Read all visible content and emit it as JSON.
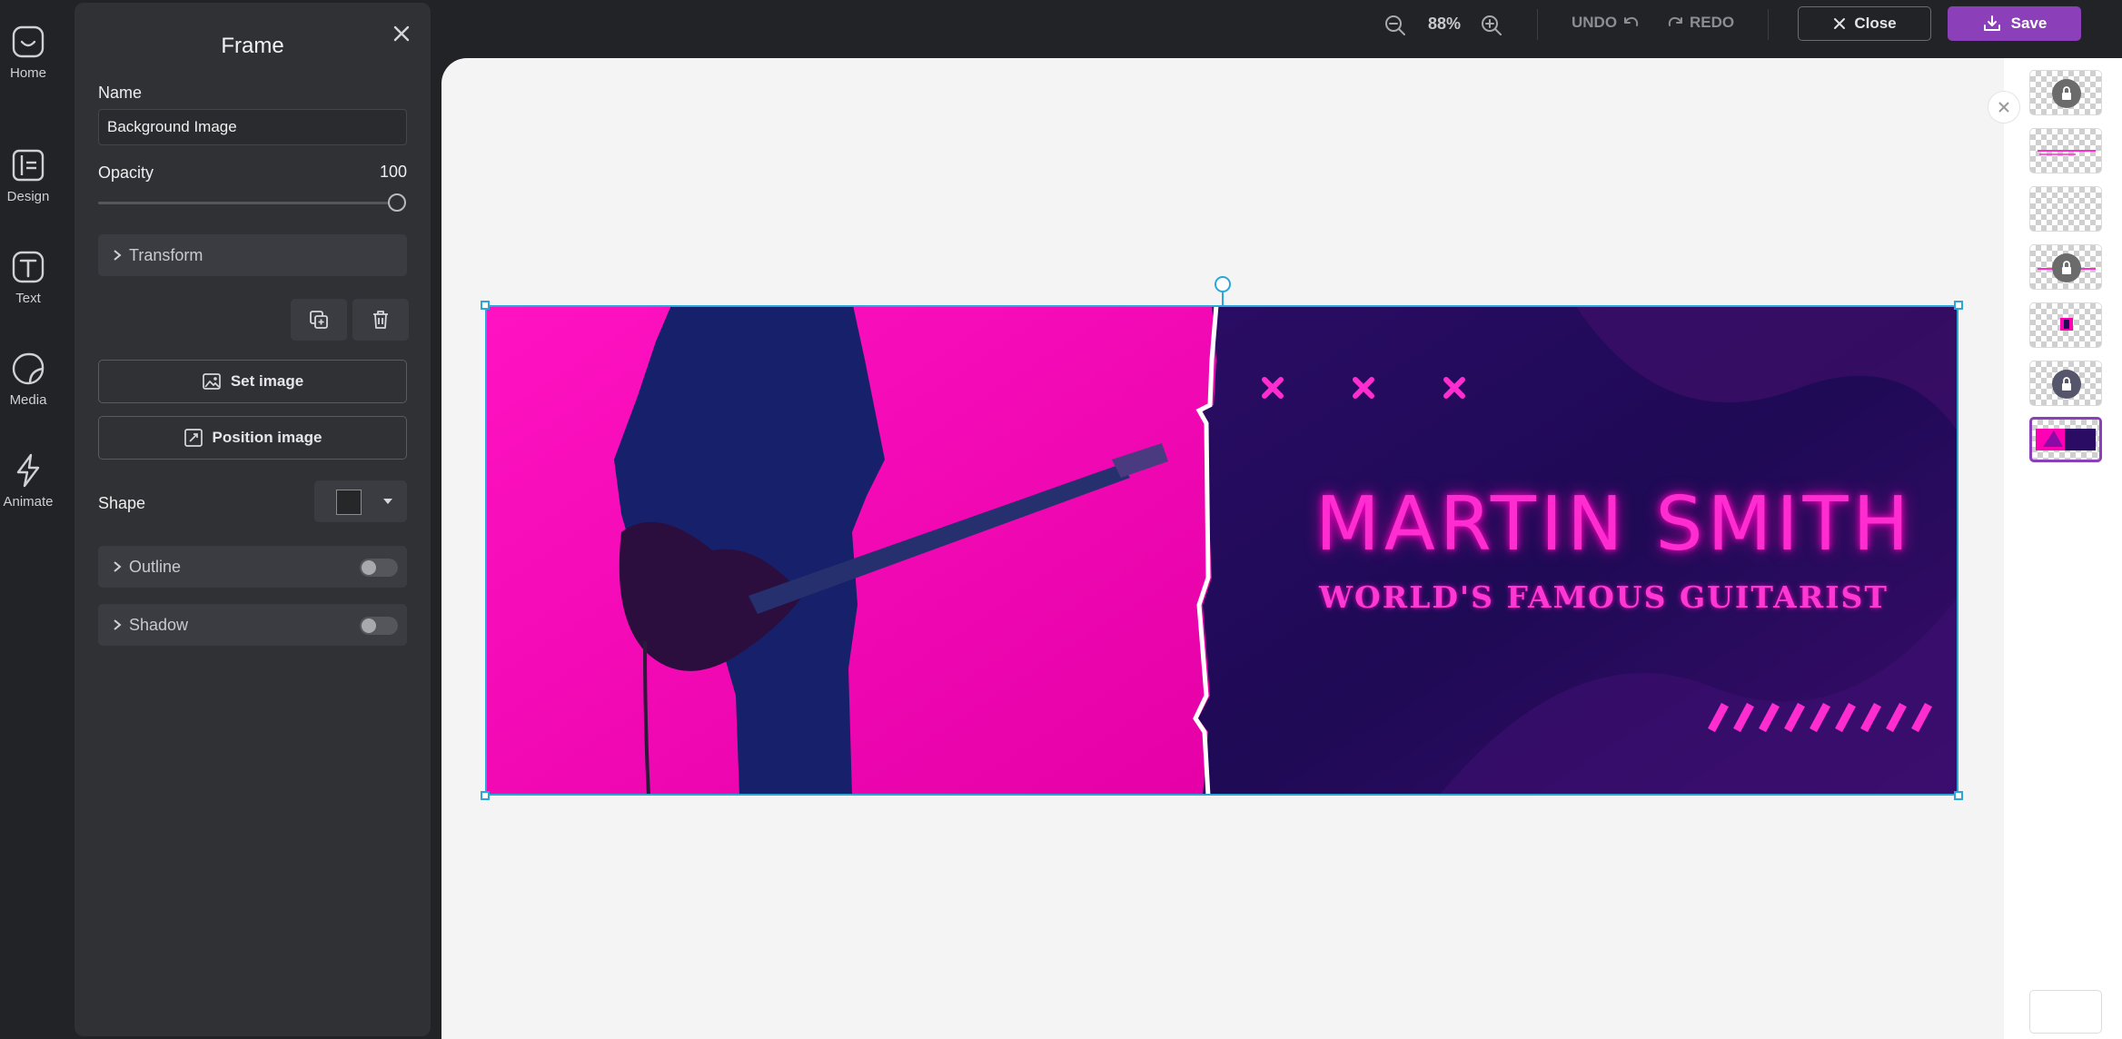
{
  "rail": {
    "items": [
      {
        "label": "Home",
        "icon": "home-icon"
      },
      {
        "label": "Design",
        "icon": "design-icon"
      },
      {
        "label": "Text",
        "icon": "text-icon"
      },
      {
        "label": "Media",
        "icon": "media-icon"
      },
      {
        "label": "Animate",
        "icon": "animate-icon"
      }
    ]
  },
  "panel": {
    "title": "Frame",
    "name_label": "Name",
    "name_value": "Background Image",
    "opacity_label": "Opacity",
    "opacity_value": "100",
    "opacity_level": 1.0,
    "transform_label": "Transform",
    "set_image_label": "Set image",
    "position_image_label": "Position image",
    "shape_label": "Shape",
    "outline_label": "Outline",
    "outline_on": false,
    "shadow_label": "Shadow",
    "shadow_on": false
  },
  "topbar": {
    "zoom": "88%",
    "undo_label": "UNDO",
    "redo_label": "REDO",
    "close_label": "Close",
    "save_label": "Save"
  },
  "design": {
    "headline": "MARTIN SMITH",
    "subheadline": "WORLD'S FAMOUS GUITARIST",
    "left_color": "#ff00b4",
    "right_color": "#1e0a55",
    "accent_color": "#ff2ccf"
  },
  "colors": {
    "accent": "#8b3fb8",
    "selection": "#2aa7d8"
  }
}
